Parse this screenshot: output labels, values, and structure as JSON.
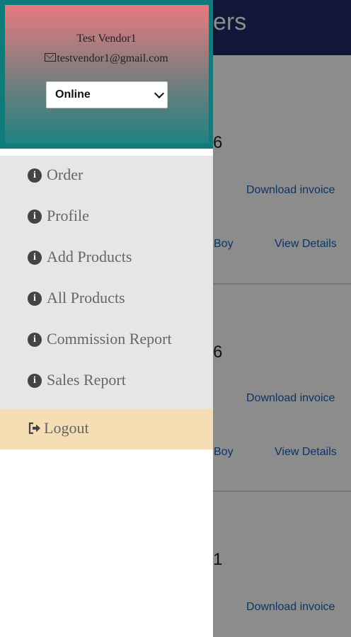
{
  "background": {
    "header_title_visible": "ers",
    "orders": [
      {
        "number_visible": "6",
        "download_label": "Download invoice",
        "assignee_visible": "Boy",
        "details_label": "View Details"
      },
      {
        "number_visible": "6",
        "download_label": "Download invoice",
        "assignee_visible": "Boy",
        "details_label": "View Details"
      },
      {
        "number_visible": "1",
        "download_label": "Download invoice"
      }
    ]
  },
  "drawer": {
    "vendor_name": "Test Vendor1",
    "vendor_email": "testvendor1@gmail.com",
    "status_select": {
      "selected": "Online"
    },
    "menu_items": [
      {
        "label": "Order",
        "icon": "info-icon"
      },
      {
        "label": "Profile",
        "icon": "info-icon"
      },
      {
        "label": "Add Products",
        "icon": "info-icon"
      },
      {
        "label": "All Products",
        "icon": "info-icon"
      },
      {
        "label": "Commission Report",
        "icon": "info-icon"
      },
      {
        "label": "Sales Report",
        "icon": "info-icon"
      }
    ],
    "logout": {
      "label": "Logout",
      "icon": "logout-icon"
    },
    "colors": {
      "header_border": "#0f7c7c",
      "gradient_top": "#e87a80",
      "gradient_bottom": "#1f8282",
      "menu_bg": "#e6e6e6",
      "logout_bg": "#f5deb3",
      "app_header": "#1e2a66",
      "link": "#1a5fb4"
    }
  }
}
